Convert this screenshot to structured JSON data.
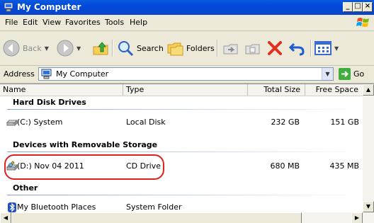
{
  "window": {
    "title": "My Computer",
    "icon": "computer-icon",
    "buttons": {
      "minimize": "_",
      "maximize": "□",
      "close": "×"
    }
  },
  "menu": [
    "File",
    "Edit",
    "View",
    "Favorites",
    "Tools",
    "Help"
  ],
  "toolbar": {
    "back_label": "Back",
    "search_label": "Search",
    "folders_label": "Folders"
  },
  "address": {
    "label": "Address",
    "value": "My Computer",
    "go_label": "Go"
  },
  "columns": {
    "name": "Name",
    "type": "Type",
    "total_size": "Total Size",
    "free_space": "Free Space"
  },
  "groups": [
    {
      "title": "Hard Disk Drives",
      "items": [
        {
          "name": "(C:) System",
          "type": "Local Disk",
          "total_size": "232 GB",
          "free_space": "151 GB",
          "icon": "hard-disk-icon"
        }
      ]
    },
    {
      "title": "Devices with Removable Storage",
      "items": [
        {
          "name": "(D:) Nov 04 2011",
          "type": "CD Drive",
          "total_size": "680 MB",
          "free_space": "435 MB",
          "icon": "cd-drive-icon"
        }
      ]
    },
    {
      "title": "Other",
      "items": [
        {
          "name": "My Bluetooth Places",
          "type": "System Folder",
          "total_size": "",
          "free_space": "",
          "icon": "bluetooth-icon"
        }
      ]
    }
  ],
  "colors": {
    "titlebar": "#0a5be0",
    "highlight_ring": "#e0201c",
    "chrome": "#ece9d8"
  }
}
